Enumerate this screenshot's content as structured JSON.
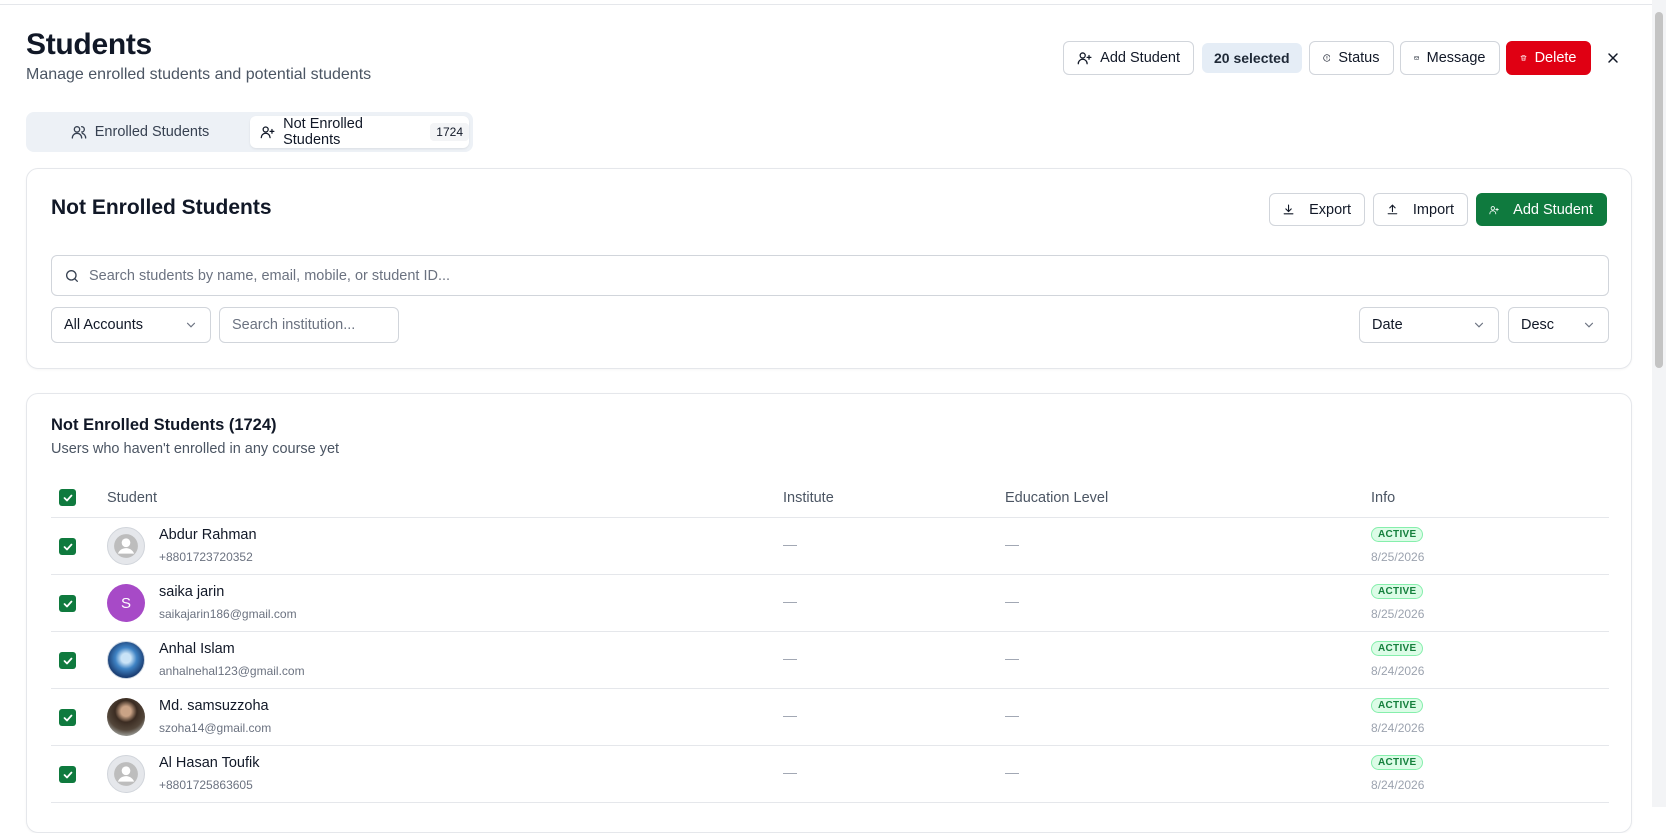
{
  "page": {
    "title": "Students",
    "subtitle": "Manage enrolled students and potential students"
  },
  "toolbar": {
    "add_student": "Add Student",
    "selected": "20 selected",
    "status": "Status",
    "message": "Message",
    "delete": "Delete"
  },
  "tabs": [
    {
      "label": "Enrolled Students"
    },
    {
      "label": "Not Enrolled Students",
      "count": "1724"
    }
  ],
  "filters_card": {
    "title": "Not Enrolled Students",
    "export": "Export",
    "import": "Import",
    "add_student": "Add Student",
    "search_placeholder": "Search students by name, email, mobile, or student ID...",
    "account_filter": "All Accounts",
    "institution_placeholder": "Search institution...",
    "sort_by": "Date",
    "sort_order": "Desc"
  },
  "table_card": {
    "title": "Not Enrolled Students (1724)",
    "subtitle": "Users who haven't enrolled in any course yet",
    "columns": [
      "Student",
      "Institute",
      "Education Level",
      "Info"
    ],
    "rows": [
      {
        "name": "Abdur Rahman",
        "contact": "+8801723720352",
        "institute": "—",
        "education": "—",
        "status": "ACTIVE",
        "date": "8/25/2026",
        "avatar": "default"
      },
      {
        "name": "saika jarin",
        "contact": "saikajarin186@gmail.com",
        "institute": "—",
        "education": "—",
        "status": "ACTIVE",
        "date": "8/25/2026",
        "avatar": "S"
      },
      {
        "name": "Anhal Islam",
        "contact": "anhalnehal123@gmail.com",
        "institute": "—",
        "education": "—",
        "status": "ACTIVE",
        "date": "8/24/2026",
        "avatar": "photo"
      },
      {
        "name": "Md. samsuzzoha",
        "contact": "szoha14@gmail.com",
        "institute": "—",
        "education": "—",
        "status": "ACTIVE",
        "date": "8/24/2026",
        "avatar": "photo"
      },
      {
        "name": "Al Hasan Toufik",
        "contact": "+8801725863605",
        "institute": "—",
        "education": "—",
        "status": "ACTIVE",
        "date": "8/24/2026",
        "avatar": "default"
      }
    ]
  },
  "colors": {
    "primary_green": "#0f7a3e",
    "danger": "#e00013",
    "badge_green": "#15803d"
  }
}
